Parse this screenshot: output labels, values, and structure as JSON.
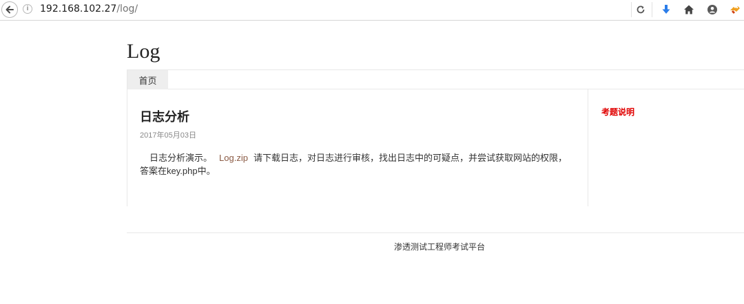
{
  "browser": {
    "url_host": "192.168.102.27",
    "url_path": "/log/",
    "icons": [
      "back-arrow-icon",
      "info-icon",
      "reload-icon",
      "download-icon",
      "home-icon",
      "account-icon",
      "extension-icon"
    ]
  },
  "site": {
    "title": "Log",
    "nav": [
      {
        "label": "首页"
      }
    ]
  },
  "post": {
    "title": "日志分析",
    "date": "2017年05月03日",
    "intro": "日志分析演示。",
    "link_text": "Log.zip",
    "after_link": "请下载日志，对日志进行审核，找出日志中的可疑点，并尝试获取网站的权限，答案在key.php中。"
  },
  "sidebar": {
    "heading": "考题说明",
    "heading_color": "#e00000"
  },
  "footer": {
    "text": "渗透测试工程师考试平台"
  }
}
